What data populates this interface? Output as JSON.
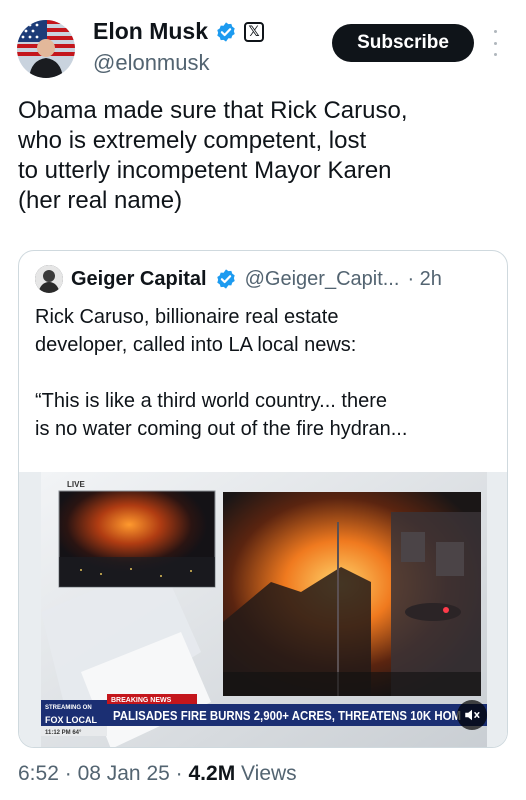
{
  "author": {
    "name": "Elon Musk",
    "handle": "@elonmusk",
    "x_badge": "𝕏",
    "subscribe_label": "Subscribe"
  },
  "tweet": {
    "text": "Obama made sure that Rick Caruso,\nwho is extremely competent, lost\nto utterly incompetent Mayor Karen\n(her real name)"
  },
  "quoted": {
    "name": "Geiger Capital",
    "handle": "@Geiger_Capit...",
    "time": "· 2h",
    "text": "Rick Caruso, billionaire real estate\ndeveloper, called into LA local news:\n\n“This is like a third world country... there\nis no water coming out of the fire hydran..."
  },
  "video": {
    "live_label": "LIVE",
    "breaking_label": "BREAKING NEWS",
    "streaming_label": "STREAMING ON",
    "brand_label": "FOX LOCAL",
    "chyron": "PALISADES FIRE BURNS 2,900+ ACRES, THREATENS 10K HOM",
    "time_temp": "11:12 PM  64°"
  },
  "footer": {
    "time": "6:52",
    "date": "08 Jan 25",
    "views": "4.2M",
    "views_label": "Views",
    "separator": "·"
  },
  "colors": {
    "verified": "#1d9bf0",
    "fox_blue": "#1b2f73",
    "breaking_red": "#c4161c"
  }
}
